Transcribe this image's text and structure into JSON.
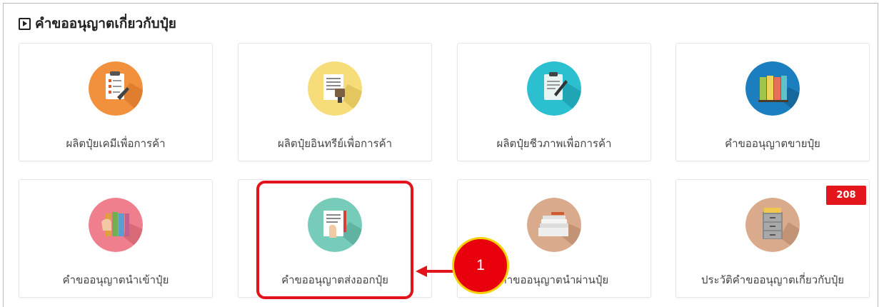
{
  "section": {
    "title": "คำขออนุญาตเกี่ยวกับปุ๋ย",
    "icon": "play-square-icon"
  },
  "cards": [
    {
      "label": "ผลิตปุ๋ยเคมีเพื่อการค้า",
      "icon": "checklist-clipboard-icon",
      "color": "#f2913d"
    },
    {
      "label": "ผลิตปุ๋ยอินทรีย์เพื่อการค้า",
      "icon": "document-stamp-icon",
      "color": "#f6dd7a"
    },
    {
      "label": "ผลิตปุ๋ยชีวภาพเพื่อการค้า",
      "icon": "clipboard-pen-icon",
      "color": "#2bbfd0"
    },
    {
      "label": "คำขออนุญาตขายปุ๋ย",
      "icon": "binders-icon",
      "color": "#1b7fbf"
    },
    {
      "label": "คำขออนุญาตนำเข้าปุ๋ย",
      "icon": "hand-binders-icon",
      "color": "#ef7f8d"
    },
    {
      "label": "คำขออนุญาตส่งออกปุ๋ย",
      "icon": "document-pen-icon",
      "color": "#77ccb9"
    },
    {
      "label": "คำขออนุญาตนำผ่านปุ๋ย",
      "icon": "paper-stack-icon",
      "color": "#d9aa8b"
    },
    {
      "label": "ประวัติคำขออนุญาตเกี่ยวกับปุ๋ย",
      "icon": "file-cabinet-icon",
      "color": "#d9aa8b",
      "badge": "208"
    }
  ],
  "annotation": {
    "step_number": "1",
    "highlight_color": "#e3131b",
    "marker_border_color": "#f5d10a"
  }
}
